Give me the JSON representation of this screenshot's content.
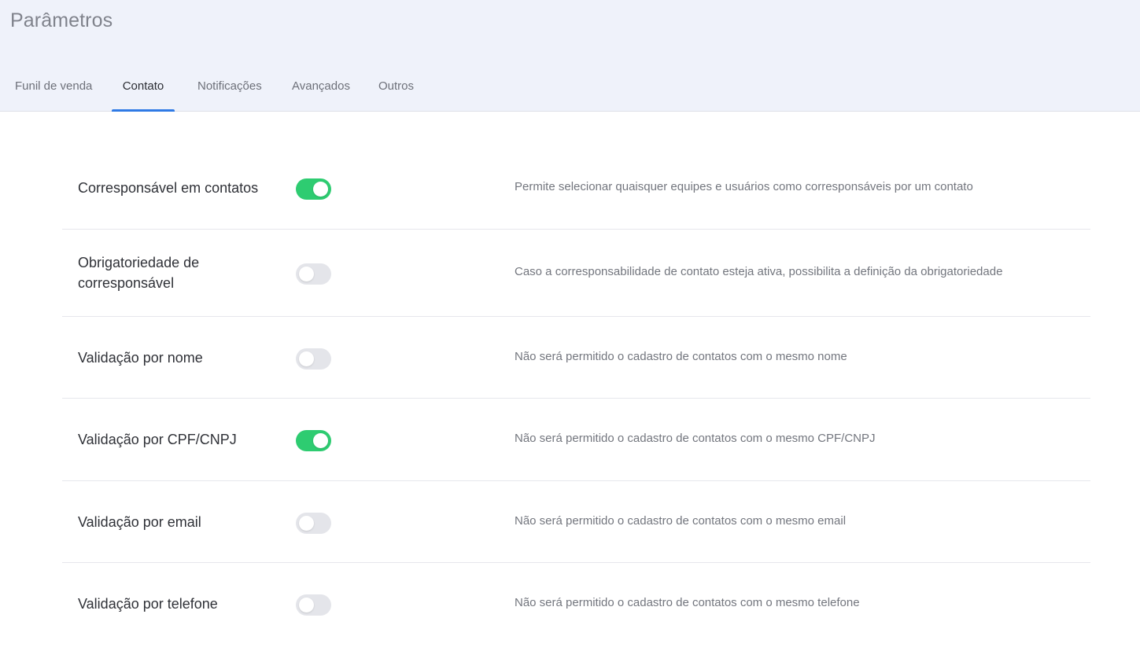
{
  "header": {
    "title": "Parâmetros"
  },
  "tabs": [
    {
      "label": "Funil de venda",
      "active": false
    },
    {
      "label": "Contato",
      "active": true
    },
    {
      "label": "Notificações",
      "active": false
    },
    {
      "label": "Avançados",
      "active": false
    },
    {
      "label": "Outros",
      "active": false
    }
  ],
  "settings": [
    {
      "label": "Corresponsável em contatos",
      "enabled": true,
      "description": "Permite selecionar quaisquer equipes e usuários como corresponsáveis por um contato"
    },
    {
      "label": "Obrigatoriedade de corresponsável",
      "enabled": false,
      "description": "Caso a corresponsabilidade de contato esteja ativa, possibilita a definição da obrigatoriedade"
    },
    {
      "label": "Validação por nome",
      "enabled": false,
      "description": "Não será permitido o cadastro de contatos com o mesmo nome"
    },
    {
      "label": "Validação por CPF/CNPJ",
      "enabled": true,
      "description": "Não será permitido o cadastro de contatos com o mesmo CPF/CNPJ"
    },
    {
      "label": "Validação por email",
      "enabled": false,
      "description": "Não será permitido o cadastro de contatos com o mesmo email"
    },
    {
      "label": "Validação por telefone",
      "enabled": false,
      "description": "Não será permitido o cadastro de contatos com o mesmo telefone"
    }
  ],
  "colors": {
    "accent": "#2f7ae5",
    "toggle_on": "#2ecc71",
    "toggle_off": "#e4e5ea",
    "header_bg": "#eff2fa"
  }
}
